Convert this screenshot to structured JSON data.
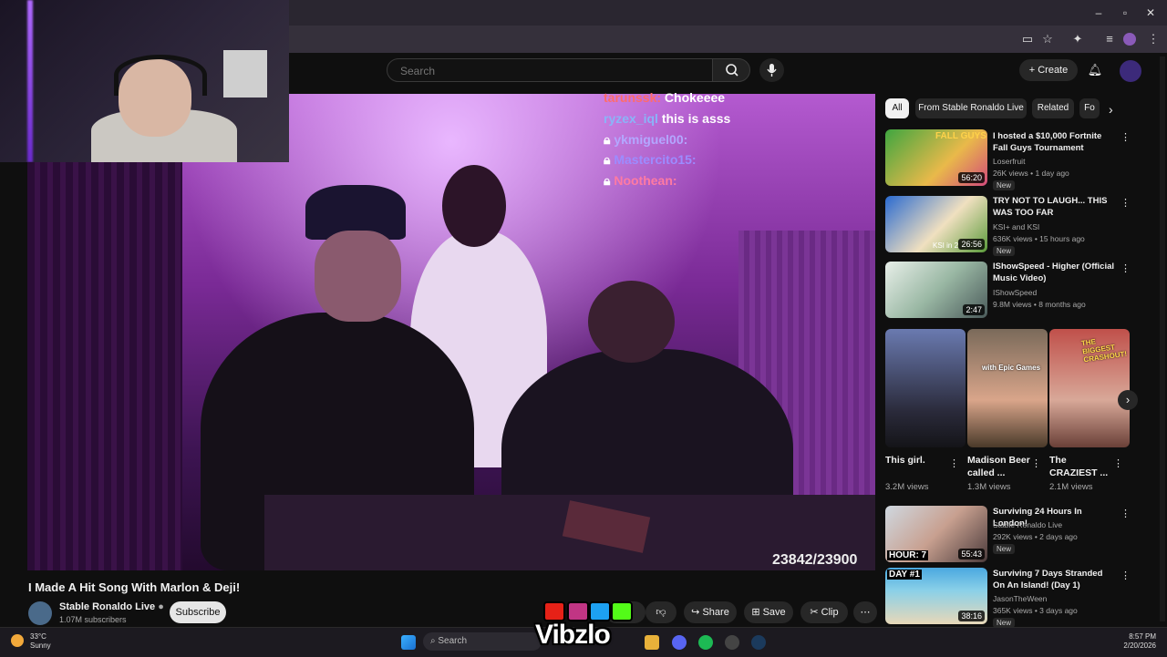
{
  "search": {
    "placeholder": "Search"
  },
  "header": {
    "create_label": "Create"
  },
  "chat": [
    {
      "user": "tarunssk:",
      "msg": "Chokeeee"
    },
    {
      "user": "ryzex_iql",
      "msg": "this is asss"
    },
    {
      "user": "ykmiguel00:",
      "msg": ""
    },
    {
      "user": "Mastercito15:",
      "msg": ""
    },
    {
      "user": "Noothean:",
      "msg": ""
    }
  ],
  "counter": "23842/23900",
  "video": {
    "title": "I Made A Hit Song With Marlon & Deji!",
    "channel": "Stable Ronaldo Live",
    "subscribers": "1.07M subscribers",
    "subscribe_label": "Subscribe",
    "likes_label": "6K",
    "share_label": "Share",
    "save_label": "Save",
    "clip_label": "Clip"
  },
  "chips": [
    "All",
    "From Stable Ronaldo Live",
    "Related",
    "Fo"
  ],
  "recommendations": [
    {
      "title": "I hosted a $10,000 Fortnite Fall Guys Tournament",
      "channel": "Loserfruit",
      "meta": "26K views • 1 day ago",
      "duration": "56:20",
      "badge": "New",
      "thumb_text": "FALL GUYS"
    },
    {
      "title": "TRY NOT TO LAUGH... THIS WAS TOO FAR",
      "channel": "KSI+ and KSI",
      "meta": "636K views • 15 hours ago",
      "duration": "26:56",
      "badge": "New",
      "thumb_text": "KSI in 2"
    },
    {
      "title": "IShowSpeed - Higher (Official Music Video)",
      "channel": "IShowSpeed",
      "meta": "9.8M views • 8 months ago",
      "duration": "2:47",
      "badge": "",
      "thumb_text": ""
    },
    {
      "title": "Surviving 24 Hours In London!",
      "channel": "Stable Ronaldo Live",
      "meta": "292K views • 2 days ago",
      "duration": "55:43",
      "badge": "New",
      "thumb_text": "HOUR: 7"
    },
    {
      "title": "Surviving 7 Days Stranded On An Island! (Day 1)",
      "channel": "JasonTheWeen",
      "meta": "365K views • 3 days ago",
      "duration": "38:16",
      "badge": "New",
      "thumb_text": "DAY #1"
    }
  ],
  "shorts": [
    {
      "title": "This girl.",
      "views": "3.2M views",
      "thumb_text": ""
    },
    {
      "title": "Madison Beer called ...",
      "views": "1.3M views",
      "thumb_text": "with Epic Games"
    },
    {
      "title": "The CRAZIEST ...",
      "views": "2.1M views",
      "thumb_text": "THE BIGGEST CRASHOUT!"
    }
  ],
  "taskbar": {
    "search_label": "Search",
    "temp": "33°C",
    "weather": "Sunny",
    "time": "8:57 PM",
    "date": "2/20/2026"
  },
  "watermark": "Vibzlo",
  "colors": {
    "accent": "#c58af9",
    "video_tint": "#9b3fc0"
  }
}
